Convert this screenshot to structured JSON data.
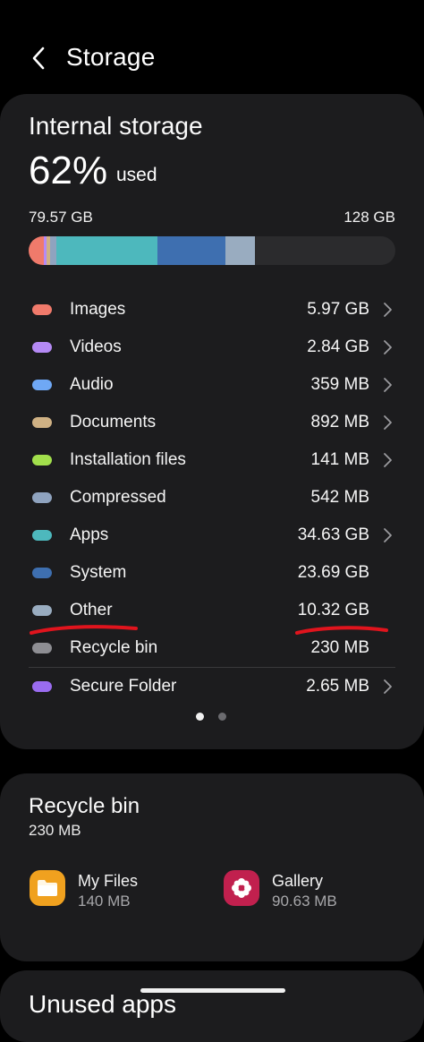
{
  "header": {
    "title": "Storage"
  },
  "storage": {
    "title": "Internal storage",
    "percent": "62%",
    "used_label": "used",
    "used_value": "79.57 GB",
    "total_value": "128 GB",
    "used_fraction": 0.62
  },
  "categories": [
    {
      "label": "Images",
      "value": "5.97 GB",
      "color": "#f07a6b",
      "chevron": true
    },
    {
      "label": "Videos",
      "value": "2.84 GB",
      "color": "#b58af5",
      "chevron": true
    },
    {
      "label": "Audio",
      "value": "359 MB",
      "color": "#6fa8f5",
      "chevron": true
    },
    {
      "label": "Documents",
      "value": "892 MB",
      "color": "#cfb184",
      "chevron": true
    },
    {
      "label": "Installation files",
      "value": "141 MB",
      "color": "#a2df4c",
      "chevron": true
    },
    {
      "label": "Compressed",
      "value": "542 MB",
      "color": "#8fa3bf",
      "chevron": false
    },
    {
      "label": "Apps",
      "value": "34.63 GB",
      "color": "#4db8bd",
      "chevron": true
    },
    {
      "label": "System",
      "value": "23.69 GB",
      "color": "#3e6fb0",
      "chevron": false
    },
    {
      "label": "Other",
      "value": "10.32 GB",
      "color": "#99acc0",
      "chevron": false
    },
    {
      "label": "Recycle bin",
      "value": "230 MB",
      "color": "#8e8e93",
      "chevron": false
    },
    {
      "label": "Secure Folder",
      "value": "2.65 MB",
      "color": "#9a6cf0",
      "chevron": true
    }
  ],
  "recycle": {
    "title": "Recycle bin",
    "size": "230 MB",
    "apps": [
      {
        "name": "My Files",
        "size": "140 MB",
        "icon": "folder-icon",
        "color": "#f0a11f"
      },
      {
        "name": "Gallery",
        "size": "90.63 MB",
        "icon": "flower-icon",
        "color": "#c1204e"
      }
    ]
  },
  "unused": {
    "title": "Unused apps"
  },
  "pager": {
    "count": 2,
    "active": 0
  },
  "colors": {
    "annotation": "#e0141d",
    "background": "#000000",
    "card": "#1c1c1e"
  }
}
